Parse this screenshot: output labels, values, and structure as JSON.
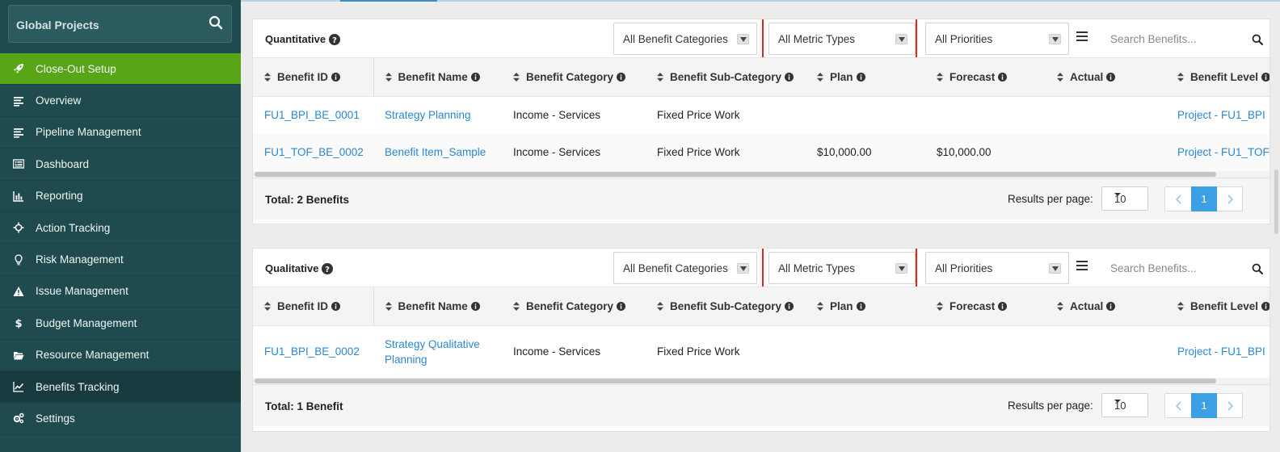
{
  "sidebar": {
    "search_label": "Global Projects",
    "items": [
      {
        "label": "Close-Out Setup",
        "icon": "rocket-icon",
        "state": "active"
      },
      {
        "label": "Overview",
        "icon": "list-icon",
        "state": ""
      },
      {
        "label": "Pipeline Management",
        "icon": "list-icon",
        "state": ""
      },
      {
        "label": "Dashboard",
        "icon": "dashboard-icon",
        "state": ""
      },
      {
        "label": "Reporting",
        "icon": "bar-chart-icon",
        "state": ""
      },
      {
        "label": "Action Tracking",
        "icon": "crosshair-icon",
        "state": ""
      },
      {
        "label": "Risk Management",
        "icon": "lightbulb-icon",
        "state": ""
      },
      {
        "label": "Issue Management",
        "icon": "warning-icon",
        "state": ""
      },
      {
        "label": "Budget Management",
        "icon": "dollar-icon",
        "state": ""
      },
      {
        "label": "Resource Management",
        "icon": "folder-open-icon",
        "state": ""
      },
      {
        "label": "Benefits Tracking",
        "icon": "line-chart-icon",
        "state": "current"
      },
      {
        "label": "Settings",
        "icon": "gears-icon",
        "state": ""
      }
    ]
  },
  "columns": [
    "Benefit ID",
    "Benefit Name",
    "Benefit Category",
    "Benefit Sub-Category",
    "Plan",
    "Forecast",
    "Actual",
    "Benefit Level"
  ],
  "filters": {
    "category": "All Benefit Categories",
    "metric": "All Metric Types",
    "priority": "All Priorities",
    "search_placeholder": "Search Benefits..."
  },
  "quantitative": {
    "title": "Quantitative",
    "rows": [
      {
        "id": "FU1_BPI_BE_0001",
        "name": "Strategy Planning",
        "category": "Income - Services",
        "subcategory": "Fixed Price Work",
        "plan": "",
        "forecast": "",
        "actual": "",
        "level": "Project - FU1_BPI"
      },
      {
        "id": "FU1_TOF_BE_0002",
        "name": "Benefit Item_Sample",
        "category": "Income - Services",
        "subcategory": "Fixed Price Work",
        "plan": "$10,000.00",
        "forecast": "$10,000.00",
        "actual": "",
        "level": "Project - FU1_TOF"
      }
    ],
    "total": "Total: 2 Benefits"
  },
  "qualitative": {
    "title": "Qualitative",
    "rows": [
      {
        "id": "FU1_BPI_BE_0002",
        "name": "Strategy Qualitative Planning",
        "category": "Income - Services",
        "subcategory": "Fixed Price Work",
        "plan": "",
        "forecast": "",
        "actual": "",
        "level": "Project - FU1_BPI"
      }
    ],
    "total": "Total: 1 Benefit"
  },
  "pagination": {
    "results_label": "Results per page:",
    "per_page": "10",
    "current_page": "1"
  },
  "colors": {
    "sidebar_bg": "#1f4a4e",
    "active_green": "#58a618",
    "link_blue": "#2b87d1",
    "highlight_red": "#e0261b",
    "pager_blue": "#3ea0e4"
  }
}
